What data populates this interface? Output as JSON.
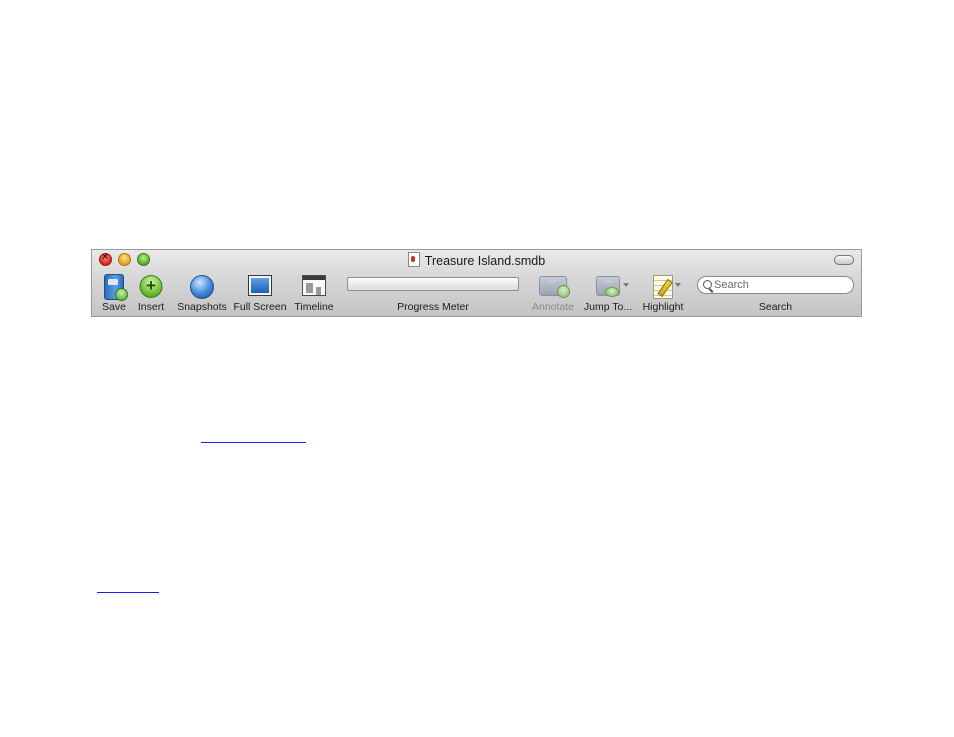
{
  "window": {
    "title": "Treasure Island.smdb"
  },
  "toolbar": {
    "items": [
      {
        "label": "Save",
        "icon": "save-icon",
        "enabled": true
      },
      {
        "label": "Insert",
        "icon": "insert-plus-icon",
        "enabled": true
      },
      {
        "label": "Snapshots",
        "icon": "snapshots-icon",
        "enabled": true
      },
      {
        "label": "Full Screen",
        "icon": "full-screen-icon",
        "enabled": true
      },
      {
        "label": "Timeline",
        "icon": "timeline-icon",
        "enabled": true
      },
      {
        "label": "Progress Meter",
        "icon": "progress-bar",
        "enabled": true
      },
      {
        "label": "Annotate",
        "icon": "annotate-icon",
        "enabled": false
      },
      {
        "label": "Jump To...",
        "icon": "jump-to-icon",
        "enabled": true
      },
      {
        "label": "Highlight",
        "icon": "highlight-icon",
        "enabled": true
      },
      {
        "label": "Search",
        "icon": "search-icon",
        "enabled": true
      }
    ],
    "progress_value": 0,
    "search": {
      "placeholder": "Search",
      "value": ""
    }
  },
  "colors": {
    "close": "#d2241b",
    "minimize": "#e0a21b",
    "zoom": "#53a82a",
    "link": "#1a1aff"
  }
}
